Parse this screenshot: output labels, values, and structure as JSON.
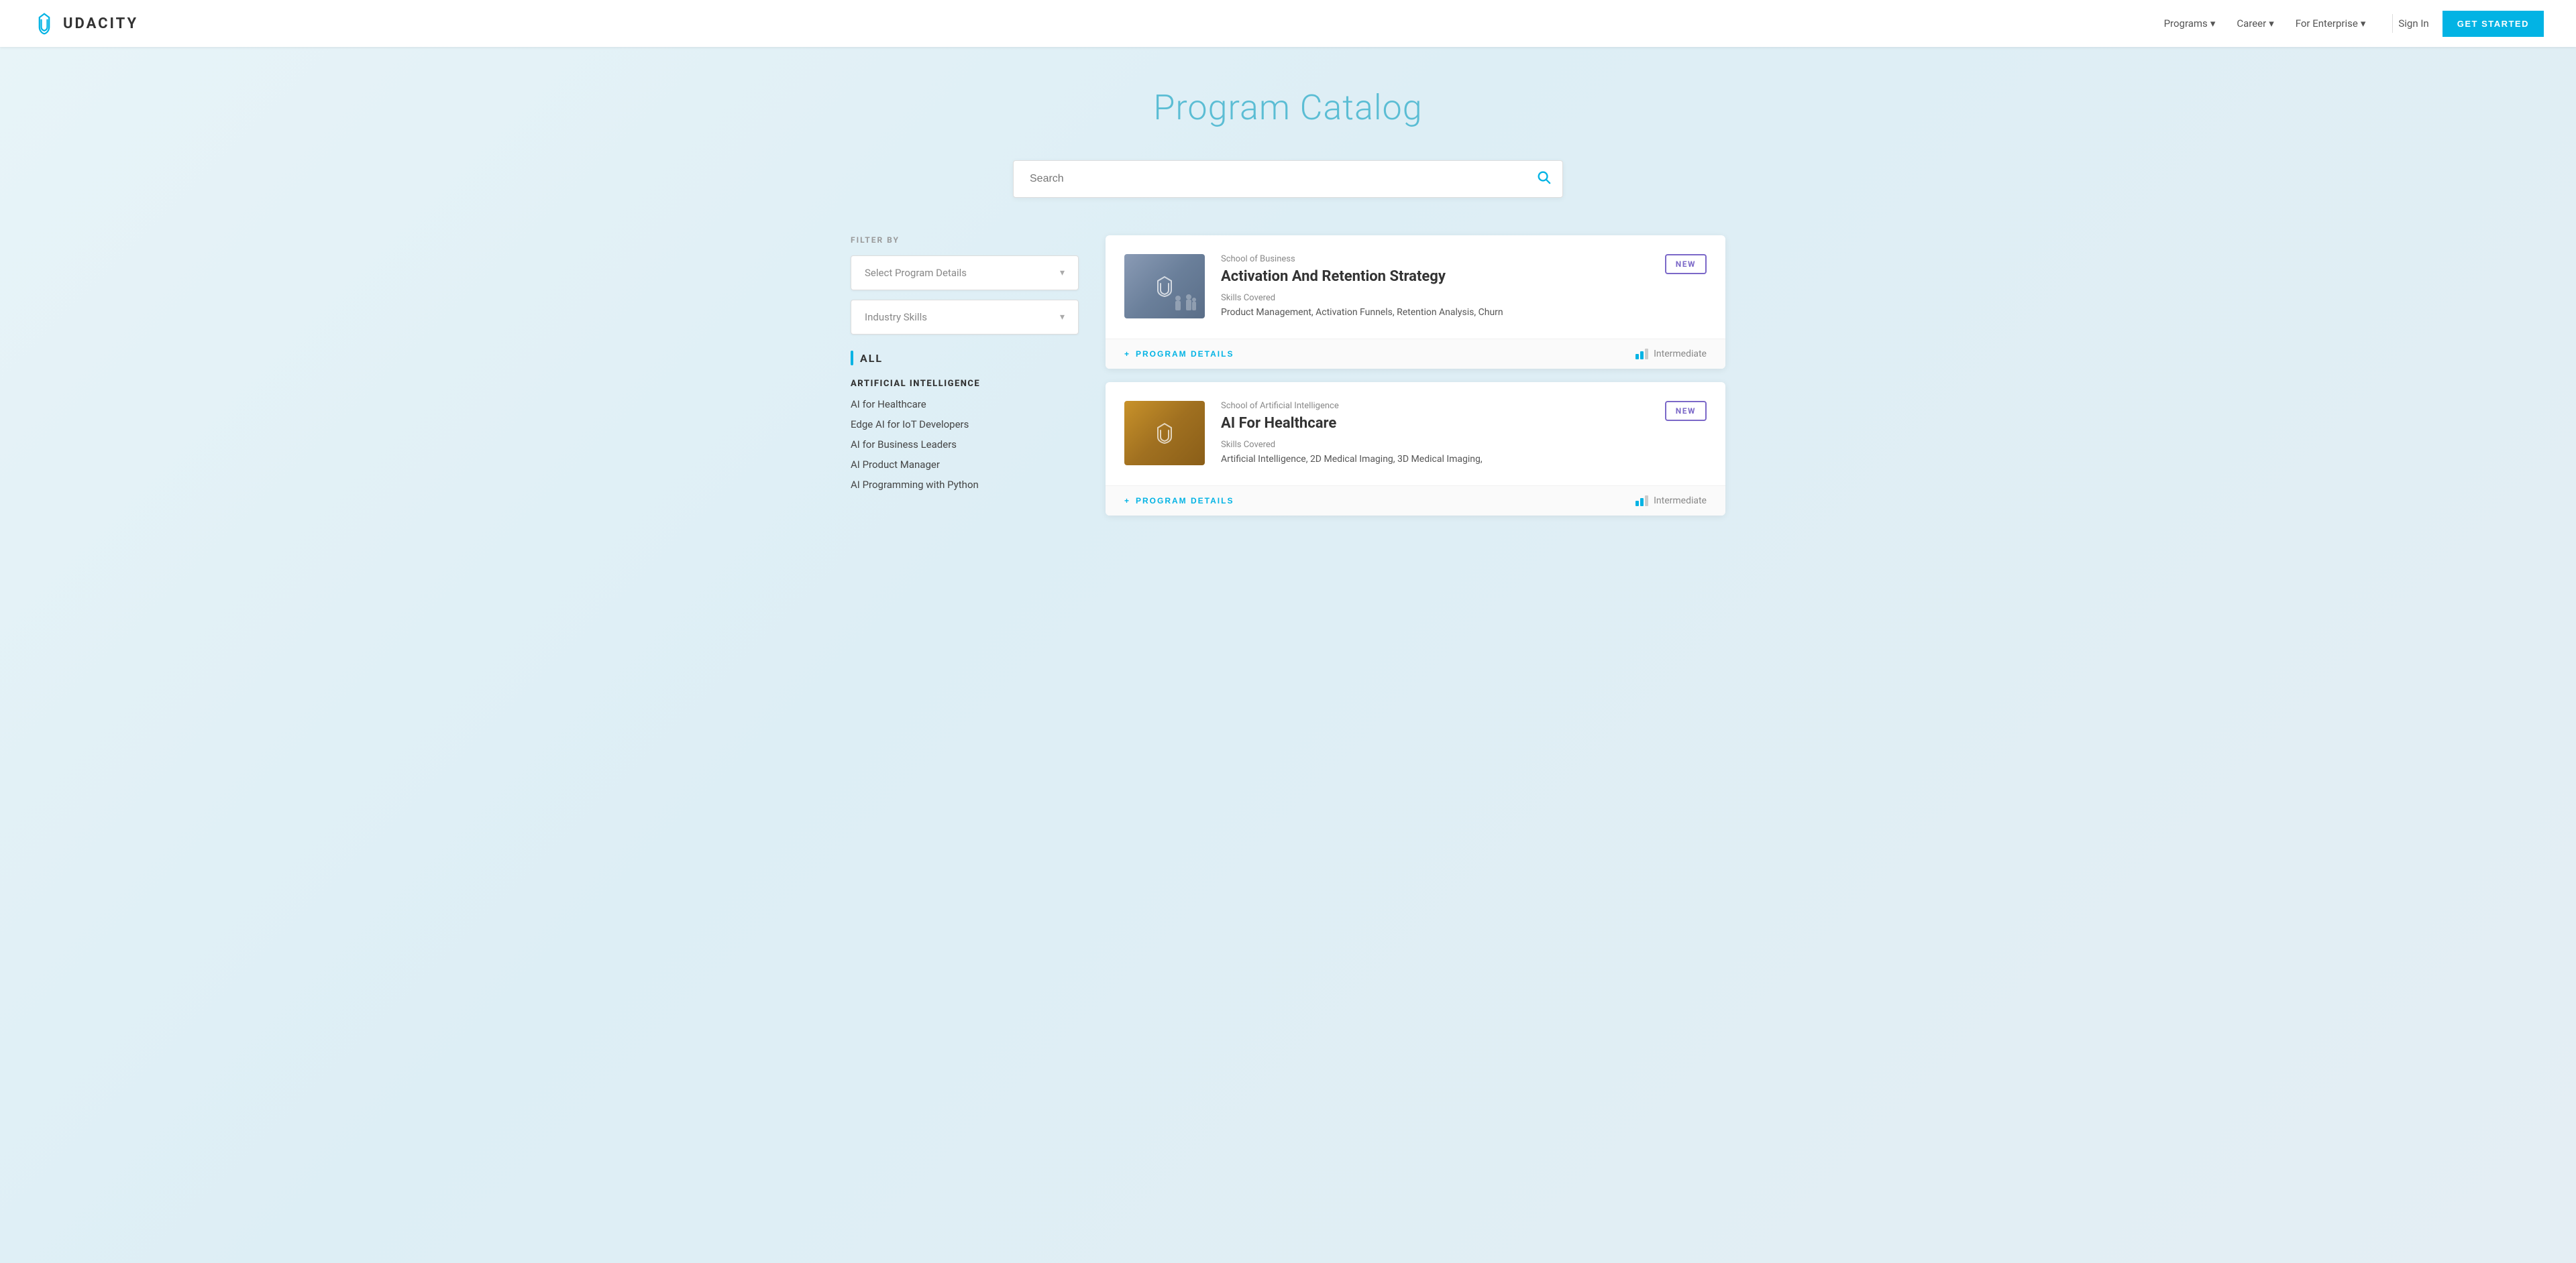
{
  "navbar": {
    "logo_text": "UDACITY",
    "nav_items": [
      {
        "label": "Programs",
        "has_dropdown": true
      },
      {
        "label": "Career",
        "has_dropdown": true
      },
      {
        "label": "For Enterprise",
        "has_dropdown": true
      }
    ],
    "sign_in": "Sign In",
    "get_started": "GET STARTED"
  },
  "page": {
    "title": "Program Catalog",
    "search_placeholder": "Search"
  },
  "filters": {
    "label": "FILTER BY",
    "program_details": {
      "label": "Select Program Details",
      "placeholder": "Select Program Details"
    },
    "industry_skills": {
      "label": "Industry Skills",
      "placeholder": "Industry Skills"
    }
  },
  "sidebar": {
    "all_label": "ALL",
    "categories": [
      {
        "title": "ARTIFICIAL INTELLIGENCE",
        "items": [
          "AI for Healthcare",
          "Edge AI for IoT Developers",
          "AI for Business Leaders",
          "AI Product Manager",
          "AI Programming with Python"
        ]
      }
    ]
  },
  "programs": [
    {
      "school": "School of Business",
      "title": "Activation And Retention Strategy",
      "badge": "NEW",
      "skills_label": "Skills Covered",
      "skills": "Product Management, Activation Funnels, Retention Analysis, Churn",
      "details_btn": "PROGRAM DETAILS",
      "level": "Intermediate",
      "thumb_type": "business"
    },
    {
      "school": "School of Artificial Intelligence",
      "title": "AI For Healthcare",
      "badge": "NEW",
      "skills_label": "Skills Covered",
      "skills": "Artificial Intelligence, 2D Medical Imaging, 3D Medical Imaging,",
      "details_btn": "PROGRAM DETAILS",
      "level": "Intermediate",
      "thumb_type": "ai"
    }
  ]
}
